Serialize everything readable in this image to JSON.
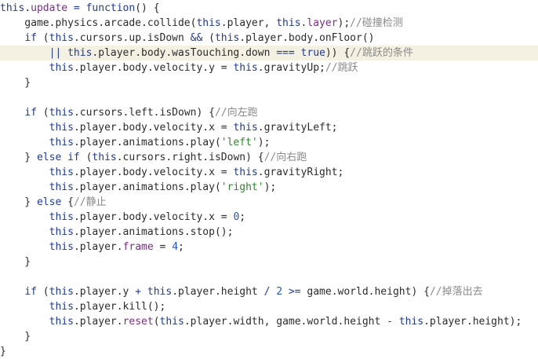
{
  "editor": {
    "lines": [
      {
        "hl": false,
        "tokens": [
          {
            "t": "this",
            "c": "kw"
          },
          {
            "t": ".",
            "c": "pl"
          },
          {
            "t": "update",
            "c": "prop"
          },
          {
            "t": " = ",
            "c": "op"
          },
          {
            "t": "function",
            "c": "kw"
          },
          {
            "t": "() {",
            "c": "pl"
          }
        ]
      },
      {
        "hl": false,
        "tokens": [
          {
            "t": "    game.physics.arcade.collide(",
            "c": "pl"
          },
          {
            "t": "this",
            "c": "kw"
          },
          {
            "t": ".player, ",
            "c": "pl"
          },
          {
            "t": "this",
            "c": "kw"
          },
          {
            "t": ".",
            "c": "pl"
          },
          {
            "t": "layer",
            "c": "prop"
          },
          {
            "t": ");",
            "c": "pl"
          },
          {
            "t": "//碰撞检测",
            "c": "cmt"
          }
        ]
      },
      {
        "hl": false,
        "tokens": [
          {
            "t": "    ",
            "c": "pl"
          },
          {
            "t": "if",
            "c": "kw"
          },
          {
            "t": " (",
            "c": "pl"
          },
          {
            "t": "this",
            "c": "kw"
          },
          {
            "t": ".cursors.up.isDown ",
            "c": "pl"
          },
          {
            "t": "&&",
            "c": "op"
          },
          {
            "t": " (",
            "c": "pl"
          },
          {
            "t": "this",
            "c": "kw"
          },
          {
            "t": ".player.body.onFloor()",
            "c": "pl"
          }
        ]
      },
      {
        "hl": true,
        "tokens": [
          {
            "t": "        ",
            "c": "pl"
          },
          {
            "t": "||",
            "c": "op"
          },
          {
            "t": " ",
            "c": "pl"
          },
          {
            "t": "this",
            "c": "kw"
          },
          {
            "t": ".player.body.wasTouching.down ",
            "c": "pl"
          },
          {
            "t": "===",
            "c": "op"
          },
          {
            "t": " ",
            "c": "pl"
          },
          {
            "t": "true",
            "c": "bool"
          },
          {
            "t": ")) {",
            "c": "pl"
          },
          {
            "t": "//跳跃的条件",
            "c": "cmt"
          }
        ]
      },
      {
        "hl": false,
        "tokens": [
          {
            "t": "        ",
            "c": "pl"
          },
          {
            "t": "this",
            "c": "kw"
          },
          {
            "t": ".player.body.velocity.y = ",
            "c": "pl"
          },
          {
            "t": "this",
            "c": "kw"
          },
          {
            "t": ".gravityUp;",
            "c": "pl"
          },
          {
            "t": "//跳跃",
            "c": "cmt"
          }
        ]
      },
      {
        "hl": false,
        "tokens": [
          {
            "t": "    }",
            "c": "pl"
          }
        ]
      },
      {
        "hl": false,
        "tokens": [
          {
            "t": "",
            "c": "pl"
          }
        ]
      },
      {
        "hl": false,
        "tokens": [
          {
            "t": "    ",
            "c": "pl"
          },
          {
            "t": "if",
            "c": "kw"
          },
          {
            "t": " (",
            "c": "pl"
          },
          {
            "t": "this",
            "c": "kw"
          },
          {
            "t": ".cursors.left.isDown) {",
            "c": "pl"
          },
          {
            "t": "//向左跑",
            "c": "cmt"
          }
        ]
      },
      {
        "hl": false,
        "tokens": [
          {
            "t": "        ",
            "c": "pl"
          },
          {
            "t": "this",
            "c": "kw"
          },
          {
            "t": ".player.body.velocity.x = ",
            "c": "pl"
          },
          {
            "t": "this",
            "c": "kw"
          },
          {
            "t": ".gravityLeft;",
            "c": "pl"
          }
        ]
      },
      {
        "hl": false,
        "tokens": [
          {
            "t": "        ",
            "c": "pl"
          },
          {
            "t": "this",
            "c": "kw"
          },
          {
            "t": ".player.animations.play(",
            "c": "pl"
          },
          {
            "t": "'left'",
            "c": "str"
          },
          {
            "t": ");",
            "c": "pl"
          }
        ]
      },
      {
        "hl": false,
        "tokens": [
          {
            "t": "    } ",
            "c": "pl"
          },
          {
            "t": "else if",
            "c": "kw"
          },
          {
            "t": " (",
            "c": "pl"
          },
          {
            "t": "this",
            "c": "kw"
          },
          {
            "t": ".cursors.right.isDown) {",
            "c": "pl"
          },
          {
            "t": "//向右跑",
            "c": "cmt"
          }
        ]
      },
      {
        "hl": false,
        "tokens": [
          {
            "t": "        ",
            "c": "pl"
          },
          {
            "t": "this",
            "c": "kw"
          },
          {
            "t": ".player.body.velocity.x = ",
            "c": "pl"
          },
          {
            "t": "this",
            "c": "kw"
          },
          {
            "t": ".gravityRight;",
            "c": "pl"
          }
        ]
      },
      {
        "hl": false,
        "tokens": [
          {
            "t": "        ",
            "c": "pl"
          },
          {
            "t": "this",
            "c": "kw"
          },
          {
            "t": ".player.animations.play(",
            "c": "pl"
          },
          {
            "t": "'right'",
            "c": "str"
          },
          {
            "t": ");",
            "c": "pl"
          }
        ]
      },
      {
        "hl": false,
        "tokens": [
          {
            "t": "    } ",
            "c": "pl"
          },
          {
            "t": "else",
            "c": "kw"
          },
          {
            "t": " {",
            "c": "pl"
          },
          {
            "t": "//静止",
            "c": "cmt"
          }
        ]
      },
      {
        "hl": false,
        "tokens": [
          {
            "t": "        ",
            "c": "pl"
          },
          {
            "t": "this",
            "c": "kw"
          },
          {
            "t": ".player.body.velocity.x = ",
            "c": "pl"
          },
          {
            "t": "0",
            "c": "num"
          },
          {
            "t": ";",
            "c": "pl"
          }
        ]
      },
      {
        "hl": false,
        "tokens": [
          {
            "t": "        ",
            "c": "pl"
          },
          {
            "t": "this",
            "c": "kw"
          },
          {
            "t": ".player.animations.stop();",
            "c": "pl"
          }
        ]
      },
      {
        "hl": false,
        "tokens": [
          {
            "t": "        ",
            "c": "pl"
          },
          {
            "t": "this",
            "c": "kw"
          },
          {
            "t": ".player.",
            "c": "pl"
          },
          {
            "t": "frame",
            "c": "prop"
          },
          {
            "t": " = ",
            "c": "pl"
          },
          {
            "t": "4",
            "c": "num"
          },
          {
            "t": ";",
            "c": "pl"
          }
        ]
      },
      {
        "hl": false,
        "tokens": [
          {
            "t": "    }",
            "c": "pl"
          }
        ]
      },
      {
        "hl": false,
        "tokens": [
          {
            "t": "",
            "c": "pl"
          }
        ]
      },
      {
        "hl": false,
        "tokens": [
          {
            "t": "    ",
            "c": "pl"
          },
          {
            "t": "if",
            "c": "kw"
          },
          {
            "t": " (",
            "c": "pl"
          },
          {
            "t": "this",
            "c": "kw"
          },
          {
            "t": ".player.y ",
            "c": "pl"
          },
          {
            "t": "+",
            "c": "op"
          },
          {
            "t": " ",
            "c": "pl"
          },
          {
            "t": "this",
            "c": "kw"
          },
          {
            "t": ".player.height ",
            "c": "pl"
          },
          {
            "t": "/",
            "c": "op"
          },
          {
            "t": " ",
            "c": "pl"
          },
          {
            "t": "2",
            "c": "num"
          },
          {
            "t": " ",
            "c": "pl"
          },
          {
            "t": ">=",
            "c": "op"
          },
          {
            "t": " game.world.height) {",
            "c": "pl"
          },
          {
            "t": "//掉落出去",
            "c": "cmt"
          }
        ]
      },
      {
        "hl": false,
        "tokens": [
          {
            "t": "        ",
            "c": "pl"
          },
          {
            "t": "this",
            "c": "kw"
          },
          {
            "t": ".player.kill();",
            "c": "pl"
          }
        ]
      },
      {
        "hl": false,
        "tokens": [
          {
            "t": "        ",
            "c": "pl"
          },
          {
            "t": "this",
            "c": "kw"
          },
          {
            "t": ".player.",
            "c": "pl"
          },
          {
            "t": "reset",
            "c": "prop"
          },
          {
            "t": "(",
            "c": "pl"
          },
          {
            "t": "this",
            "c": "kw"
          },
          {
            "t": ".player.width, game.world.height ",
            "c": "pl"
          },
          {
            "t": "-",
            "c": "op"
          },
          {
            "t": " ",
            "c": "pl"
          },
          {
            "t": "this",
            "c": "kw"
          },
          {
            "t": ".player.height);",
            "c": "pl"
          }
        ]
      },
      {
        "hl": false,
        "tokens": [
          {
            "t": "    }",
            "c": "pl"
          }
        ]
      },
      {
        "hl": false,
        "tokens": [
          {
            "t": "}",
            "c": "pl"
          }
        ]
      }
    ]
  }
}
